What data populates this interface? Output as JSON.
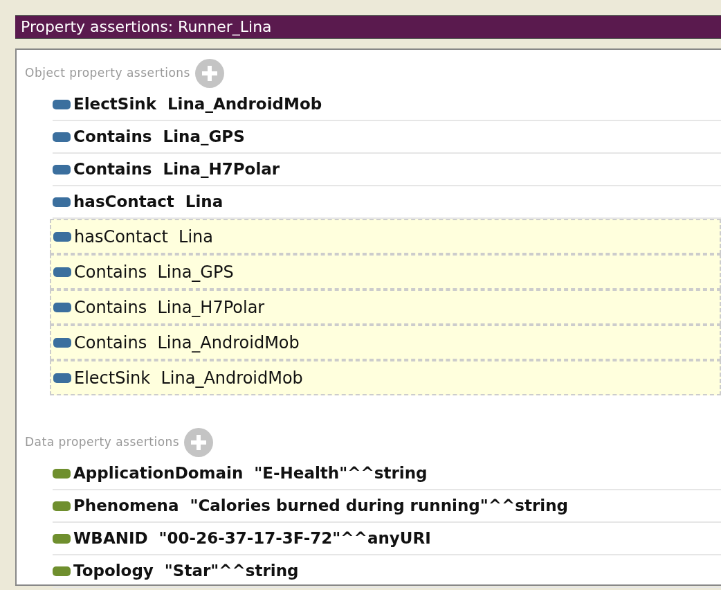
{
  "window": {
    "title": "Property assertions: Runner_Lina"
  },
  "sections": [
    {
      "kind": "object",
      "heading": "Object property assertions",
      "rows": [
        {
          "text": "ElectSink  Lina_AndroidMob",
          "inferred": false
        },
        {
          "text": "Contains  Lina_GPS",
          "inferred": false
        },
        {
          "text": "Contains  Lina_H7Polar",
          "inferred": false
        },
        {
          "text": "hasContact  Lina",
          "inferred": false
        },
        {
          "text": "hasContact  Lina",
          "inferred": true
        },
        {
          "text": "Contains  Lina_GPS",
          "inferred": true
        },
        {
          "text": "Contains  Lina_H7Polar",
          "inferred": true
        },
        {
          "text": "Contains  Lina_AndroidMob",
          "inferred": true
        },
        {
          "text": "ElectSink  Lina_AndroidMob",
          "inferred": true
        }
      ]
    },
    {
      "kind": "data",
      "heading": "Data property assertions",
      "rows": [
        {
          "text": "ApplicationDomain  \"E-Health\"^^string",
          "inferred": false
        },
        {
          "text": "Phenomena  \"Calories burned during running\"^^string",
          "inferred": false
        },
        {
          "text": "WBANID  \"00-26-37-17-3F-72\"^^anyURI",
          "inferred": false
        },
        {
          "text": "Topology  \"Star\"^^string",
          "inferred": false
        }
      ]
    }
  ]
}
